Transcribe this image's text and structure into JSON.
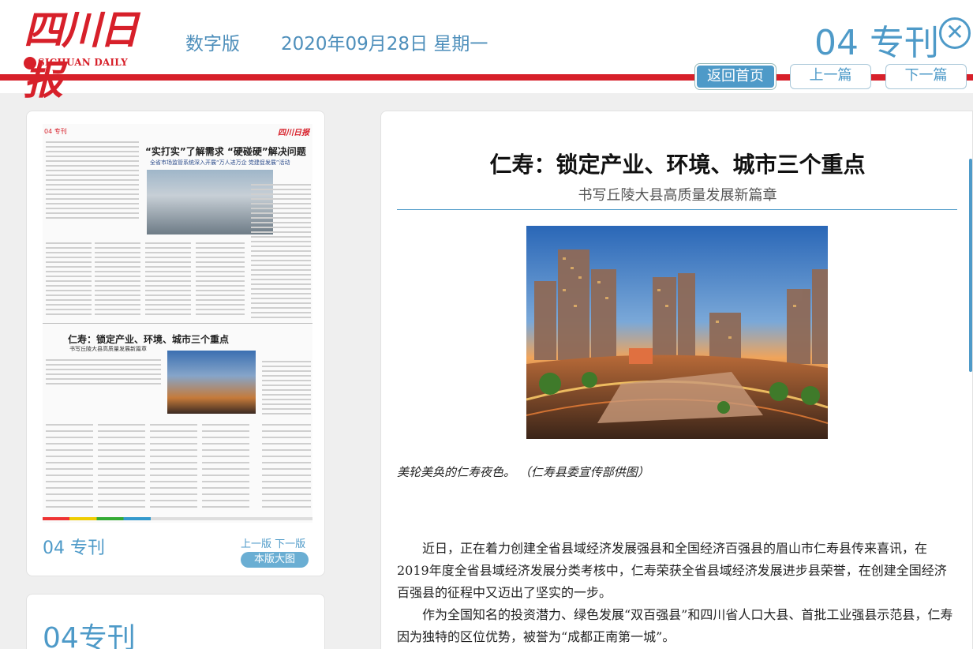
{
  "header": {
    "logo_cn": "四川日报",
    "logo_en": "SICHUAN DAILY",
    "edition": "数字版",
    "date": "2020年09月28日 星期一",
    "page_title": "04 专刊",
    "close_icon": "close-circle-icon"
  },
  "nav": {
    "home": "返回首页",
    "prev": "上一篇",
    "next": "下一篇"
  },
  "thumbnail": {
    "header": "04 专刊",
    "logo": "四川日报",
    "headline1": "“实打实”了解需求 “硬碰硬”解决问题",
    "subhead1": "全省市场监管系统深入开展“万人进万企 党建促发展”活动",
    "headline2": "仁寿：锁定产业、环境、城市三个重点",
    "subhead2": "书写丘陵大县高质量发展新篇章",
    "label": "04 专刊",
    "links": "上一版 下一版",
    "big_button": "本版大图"
  },
  "card2": {
    "title": "04专刊"
  },
  "article": {
    "title": "仁寿：锁定产业、环境、城市三个重点",
    "subtitle": "书写丘陵大县高质量发展新篇章",
    "caption": "美轮美奂的仁寿夜色。  （仁寿县委宣传部供图）",
    "paragraphs": [
      "近日，正在着力创建全省县域经济发展强县和全国经济百强县的眉山市仁寿县传来喜讯，在2019年度全省县域经济发展分类考核中，仁寿荣获全省县域经济发展进步县荣誉，在创建全国经济百强县的征程中又迈出了坚实的一步。",
      "作为全国知名的投资潜力、绿色发展“双百强县”和四川省人口大县、首批工业强县示范县，仁寿因为独特的区位优势，被誉为“成都正南第一城”。"
    ]
  },
  "colors": {
    "brand_red": "#d7202a",
    "accent_blue": "#4e9ac8"
  }
}
